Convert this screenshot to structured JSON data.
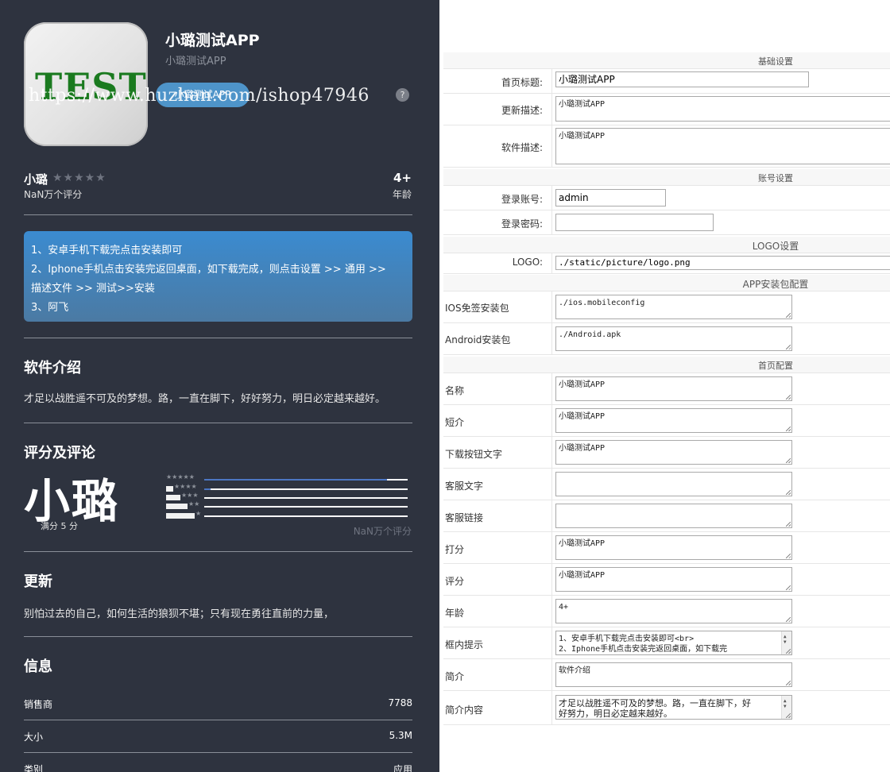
{
  "preview": {
    "app_icon_text": "TEST",
    "app_name": "小璐测试APP",
    "app_subtitle": "小璐测试APP",
    "download_label": "小璐测试APP",
    "help_label": "?",
    "watermark": "https://www.huzhan.com/ishop47946",
    "rating_name": "小璐",
    "rating_stars": "★★★★★",
    "rating_count": "NaN万个评分",
    "age_value": "4+",
    "age_label": "年龄",
    "notice_lines": [
      "1、安卓手机下载完点击安装即可",
      "2、Iphone手机点击安装完返回桌面，如下载完成，则点击设置 >> 通用 >>",
      "描述文件 >> 测试>>安装",
      "3、阿飞"
    ],
    "intro_title": "软件介绍",
    "intro_text": "才足以战胜遥不可及的梦想。路，一直在脚下，好好努力，明日必定越来越好。",
    "reviews_title": "评分及评论",
    "big_score": "小璐",
    "full_score": "满分 5 分",
    "rating_bars": [
      {
        "stars": "★★★★★",
        "fraction": 0.9
      },
      {
        "stars": "★★★★",
        "fraction": 0.03
      },
      {
        "stars": "★★★",
        "fraction": 0
      },
      {
        "stars": "★★",
        "fraction": 0
      },
      {
        "stars": "★",
        "fraction": 0
      }
    ],
    "review_count": "NaN万个评分",
    "update_title": "更新",
    "update_text": "别怕过去的自己，如何生活的狼狈不堪；只有现在勇往直前的力量，",
    "info_title": "信息",
    "info_rows": [
      {
        "key": "销售商",
        "value": "7788"
      },
      {
        "key": "大小",
        "value": "5.3M"
      },
      {
        "key": "类别",
        "value": "应用"
      }
    ]
  },
  "config": {
    "basic": {
      "header": "基础设置",
      "home_title_label": "首页标题:",
      "home_title_value": "小璐测试APP",
      "update_desc_label": "更新描述:",
      "update_desc_value": "小璐测试APP",
      "software_desc_label": "软件描述:",
      "software_desc_value": "小璐测试APP"
    },
    "account": {
      "header": "账号设置",
      "login_account_label": "登录账号:",
      "login_account_value": "admin",
      "login_password_label": "登录密码:",
      "login_password_value": ""
    },
    "logo": {
      "header": "LOGO设置",
      "logo_label": "LOGO:",
      "logo_value": "./static/picture/logo.png"
    },
    "package": {
      "header": "APP安装包配置",
      "ios_label": "IOS免签安装包",
      "ios_value": "./ios.mobileconfig",
      "android_label": "Android安装包",
      "android_value": "./Android.apk"
    },
    "home": {
      "header": "首页配置",
      "fields": [
        {
          "label": "名称",
          "value": "小璐测试APP"
        },
        {
          "label": "短介",
          "value": "小璐测试APP"
        },
        {
          "label": "下载按钮文字",
          "value": "小璐测试APP"
        },
        {
          "label": "客服文字",
          "value": ""
        },
        {
          "label": "客服链接",
          "value": ""
        },
        {
          "label": "打分",
          "value": "小璐测试APP"
        },
        {
          "label": "评分",
          "value": "小璐测试APP"
        },
        {
          "label": "年龄",
          "value": "4+"
        },
        {
          "label": "框内提示",
          "value": "1、安卓手机下载完点击安装即可<br>",
          "value2": "2、Iphone手机点击安装完返回桌面，如下载完"
        },
        {
          "label": "简介",
          "value": "软件介绍"
        },
        {
          "label": "简介内容",
          "value": "才足以战胜遥不可及的梦想。路，一直在脚下，好",
          "value2": "好努力，明日必定越来越好。"
        }
      ]
    }
  }
}
